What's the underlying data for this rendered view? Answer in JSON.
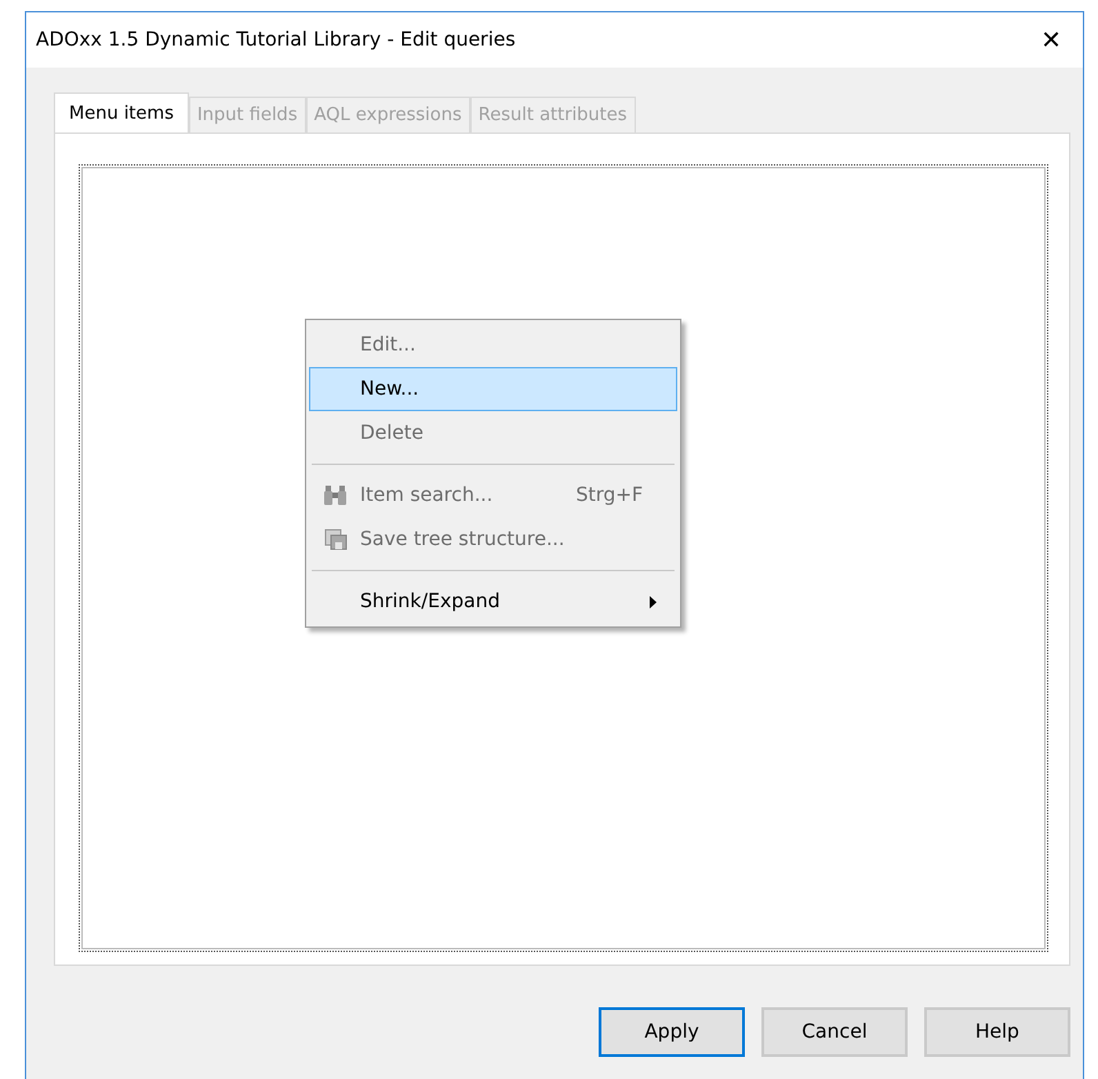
{
  "window": {
    "title": "ADOxx 1.5 Dynamic Tutorial Library - Edit queries",
    "close": "✕"
  },
  "tabs": [
    {
      "label": "Menu items",
      "selected": true,
      "disabled": false
    },
    {
      "label": "Input fields",
      "selected": false,
      "disabled": true
    },
    {
      "label": "AQL expressions",
      "selected": false,
      "disabled": true
    },
    {
      "label": "Result attributes",
      "selected": false,
      "disabled": true
    }
  ],
  "context_menu": {
    "items": [
      {
        "kind": "item",
        "label": "Edit...",
        "disabled": true,
        "selected": false
      },
      {
        "kind": "item",
        "label": "New...",
        "disabled": false,
        "selected": true
      },
      {
        "kind": "item",
        "label": "Delete",
        "disabled": true,
        "selected": false
      },
      {
        "kind": "separator"
      },
      {
        "kind": "item",
        "label": "Item search...",
        "shortcut": "Strg+F",
        "disabled": true,
        "selected": false
      },
      {
        "kind": "item",
        "label": "Save tree structure...",
        "disabled": true,
        "selected": false
      },
      {
        "kind": "separator"
      },
      {
        "kind": "submenu",
        "label": "Shrink/Expand",
        "disabled": false,
        "selected": false
      }
    ]
  },
  "buttons": [
    {
      "label": "Apply",
      "default": true
    },
    {
      "label": "Cancel",
      "default": false
    },
    {
      "label": "Help",
      "default": false
    }
  ]
}
